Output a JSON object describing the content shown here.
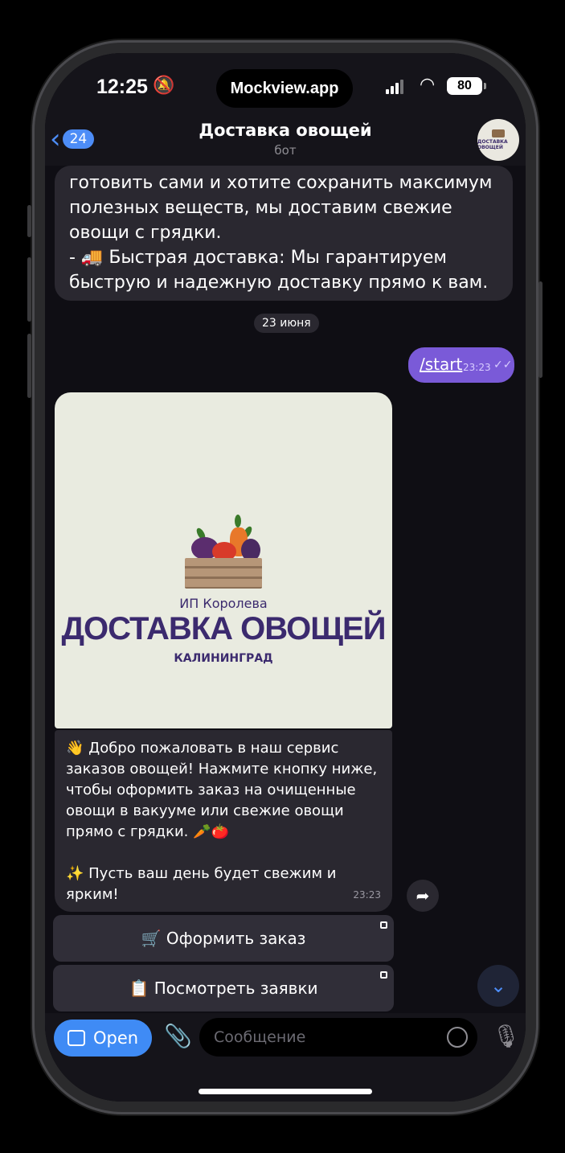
{
  "status_bar": {
    "time": "12:25",
    "island_text": "Mockview.app",
    "battery": "80"
  },
  "header": {
    "back_count": "24",
    "title": "Доставка овощей",
    "subtitle": "бот"
  },
  "messages": {
    "top_text": "готовить сами и хотите сохранить максимум полезных веществ, мы доставим свежие овощи с грядки.\n- 🚚 Быстрая доставка: Мы гарантируем быструю и надежную доставку прямо к вам.",
    "date_separator": "23 июня",
    "outgoing_command": "/start",
    "outgoing_time": "23:23",
    "logo_owner": "ИП Королева",
    "logo_title": "ДОСТАВКА ОВОЩЕЙ",
    "logo_city": "КАЛИНИНГРАД",
    "caption": "👋 Добро пожаловать в наш сервис заказов овощей! Нажмите кнопку ниже, чтобы оформить заказ на очищенные овощи в вакууме или свежие овощи прямо с грядки. 🥕🍅\n\n✨ Пусть ваш день будет свежим и ярким!",
    "caption_time": "23:23"
  },
  "keyboard": {
    "order_label": "🛒 Оформить заказ",
    "view_label": "📋 Посмотреть заявки"
  },
  "input_bar": {
    "open_label": "Open",
    "placeholder": "Сообщение"
  },
  "colors": {
    "accent": "#4d8df7",
    "outgoing_bubble": "#7a5ad8",
    "incoming_bubble": "#2a2830"
  }
}
